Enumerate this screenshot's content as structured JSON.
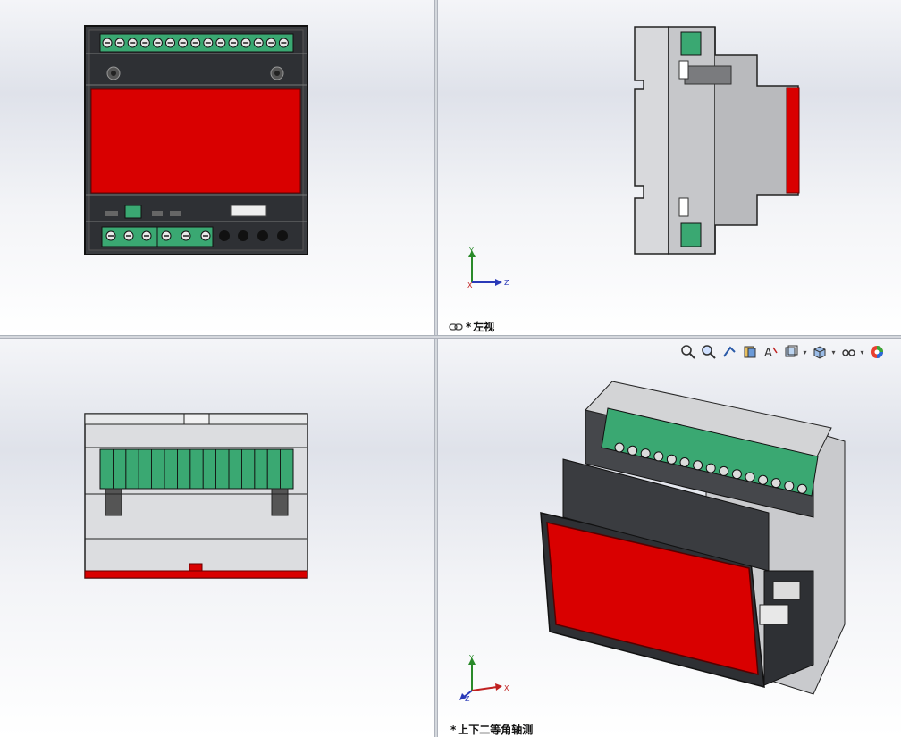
{
  "viewports": {
    "front": {
      "label": ""
    },
    "left": {
      "label_prefix": "*",
      "label": "左视"
    },
    "top": {
      "label": ""
    },
    "iso": {
      "label_prefix": "*",
      "label": "上下二等角轴测"
    }
  },
  "triad": {
    "x": "X",
    "y": "Y",
    "z": "Z"
  },
  "heads_up_toolbar": {
    "items": [
      "zoom-to-fit",
      "zoom-to-area",
      "previous-view",
      "section-view",
      "dynamic-annotation-views",
      "view-orientation",
      "display-style",
      "hide-show-items",
      "edit-appearance"
    ]
  },
  "colors": {
    "red_panel": "#d90000",
    "terminal_green": "#3aa872",
    "housing_gray": "#cfd0d2",
    "dark_body": "#2b2d30"
  }
}
